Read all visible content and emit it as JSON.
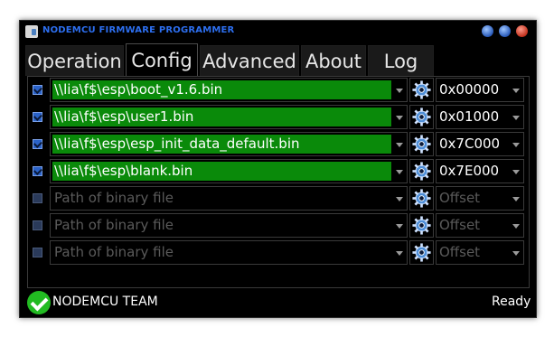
{
  "window": {
    "title": "NODEMCU FIRMWARE PROGRAMMER"
  },
  "tabs": [
    {
      "label": "Operation"
    },
    {
      "label": "Config"
    },
    {
      "label": "Advanced"
    },
    {
      "label": "About"
    },
    {
      "label": "Log"
    }
  ],
  "active_tab": "Config",
  "rows": [
    {
      "checked": true,
      "path": "\\\\lia\\f$\\esp\\boot_v1.6.bin",
      "offset": "0x00000"
    },
    {
      "checked": true,
      "path": "\\\\lia\\f$\\esp\\user1.bin",
      "offset": "0x01000"
    },
    {
      "checked": true,
      "path": "\\\\lia\\f$\\esp\\esp_init_data_default.bin",
      "offset": "0x7C000"
    },
    {
      "checked": true,
      "path": "\\\\lia\\f$\\esp\\blank.bin",
      "offset": "0x7E000"
    },
    {
      "checked": false,
      "path": "Path of binary file",
      "offset": "Offset"
    },
    {
      "checked": false,
      "path": "Path of binary file",
      "offset": "Offset"
    },
    {
      "checked": false,
      "path": "Path of binary file",
      "offset": "Offset"
    }
  ],
  "status": {
    "team": "NODEMCU TEAM",
    "state": "Ready",
    "icon": "check-circle-icon"
  },
  "colors": {
    "title": "#2d6ff0",
    "path_fill": "#0a8a0a",
    "background": "#000000",
    "placeholder": "#5a5a5a"
  }
}
